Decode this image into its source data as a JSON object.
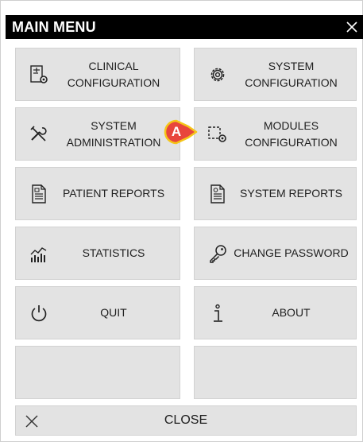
{
  "window": {
    "title": "MAIN MENU",
    "close_icon": "close-icon"
  },
  "tiles": [
    {
      "label": "CLINICAL\nCONFIGURATION",
      "icon": "clinical-configuration-icon"
    },
    {
      "label": "SYSTEM\nCONFIGURATION",
      "icon": "gear-icon"
    },
    {
      "label": "SYSTEM\nADMINISTRATION",
      "icon": "tools-icon"
    },
    {
      "label": "MODULES\nCONFIGURATION",
      "icon": "modules-configuration-icon"
    },
    {
      "label": "PATIENT REPORTS",
      "icon": "report-document-icon"
    },
    {
      "label": "SYSTEM REPORTS",
      "icon": "system-report-document-icon"
    },
    {
      "label": "STATISTICS",
      "icon": "statistics-chart-icon"
    },
    {
      "label": "CHANGE PASSWORD",
      "icon": "key-icon"
    },
    {
      "label": "QUIT",
      "icon": "power-icon"
    },
    {
      "label": "ABOUT",
      "icon": "info-icon"
    }
  ],
  "close": {
    "label": "CLOSE",
    "icon": "close-icon"
  },
  "callout": {
    "letter": "A",
    "color": "#e8453c",
    "outline": "#f5c518"
  },
  "colors": {
    "titlebar": "#000000",
    "tile": "#e3e3e3",
    "text": "#202020"
  }
}
